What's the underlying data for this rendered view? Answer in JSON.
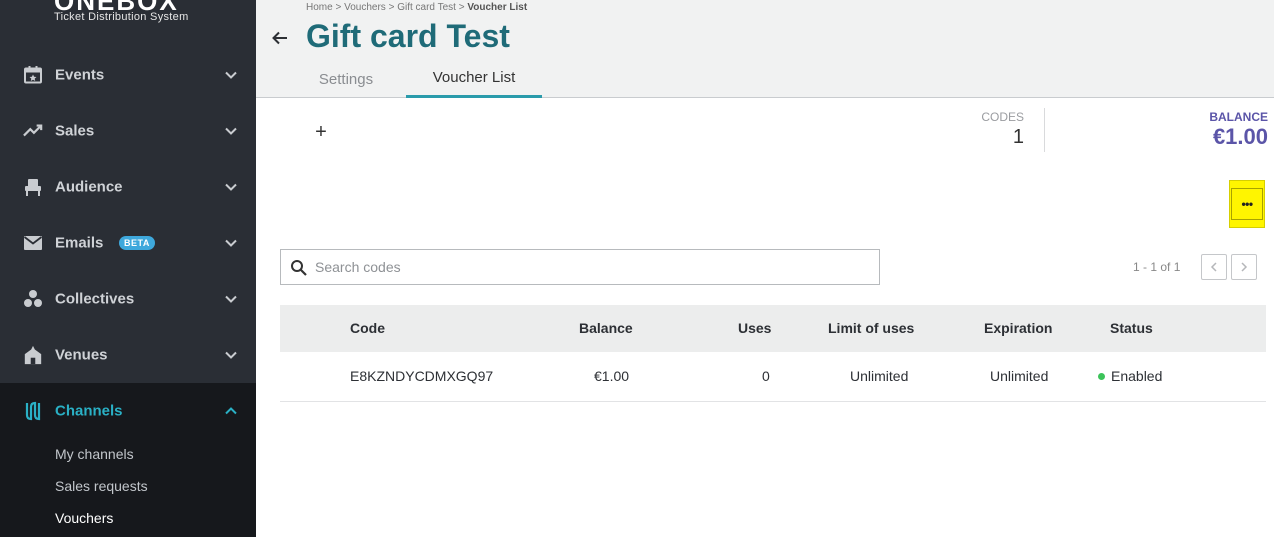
{
  "brand": {
    "name": "ONEBOX",
    "subtitle": "Ticket Distribution System"
  },
  "sidebar": {
    "items": [
      {
        "label": "Events",
        "icon": "calendar-star-icon"
      },
      {
        "label": "Sales",
        "icon": "trending-up-icon"
      },
      {
        "label": "Audience",
        "icon": "seat-icon"
      },
      {
        "label": "Emails",
        "icon": "envelope-icon",
        "badge": "BETA"
      },
      {
        "label": "Collectives",
        "icon": "group-icon"
      },
      {
        "label": "Venues",
        "icon": "building-icon"
      },
      {
        "label": "Channels",
        "icon": "channels-icon"
      }
    ],
    "subitems": [
      "My channels",
      "Sales requests",
      "Vouchers"
    ]
  },
  "header": {
    "breadcrumb": {
      "home": "Home",
      "vouchers": "Vouchers",
      "gift": "Gift card Test",
      "current": "Voucher List",
      "sep": ">"
    },
    "title": "Gift card Test",
    "tabs": [
      {
        "label": "Settings"
      },
      {
        "label": "Voucher List"
      }
    ]
  },
  "stats": {
    "codes_label": "CODES",
    "codes_value": "1",
    "balance_label": "BALANCE",
    "balance_value": "€1.00"
  },
  "actions": {
    "add_label": "+",
    "more_label": "•••"
  },
  "search": {
    "placeholder": "Search codes",
    "value": ""
  },
  "pagination": {
    "text": "1 - 1 of 1"
  },
  "table": {
    "columns": [
      "Code",
      "Balance",
      "Uses",
      "Limit of uses",
      "Expiration",
      "Status"
    ],
    "rows": [
      {
        "code": "E8KZNDYCDMXGQ97",
        "balance": "€1.00",
        "uses": "0",
        "limit": "Unlimited",
        "expiration": "Unlimited",
        "status": "Enabled"
      }
    ]
  },
  "colors": {
    "accent": "#1f6b78",
    "tab_underline": "#2a9bab",
    "balance": "#5b55a8",
    "highlight": "#fff500",
    "status_enabled": "#3cc35a",
    "sidebar_bg": "#2a2e35",
    "sidebar_active_bg": "#16181c"
  }
}
